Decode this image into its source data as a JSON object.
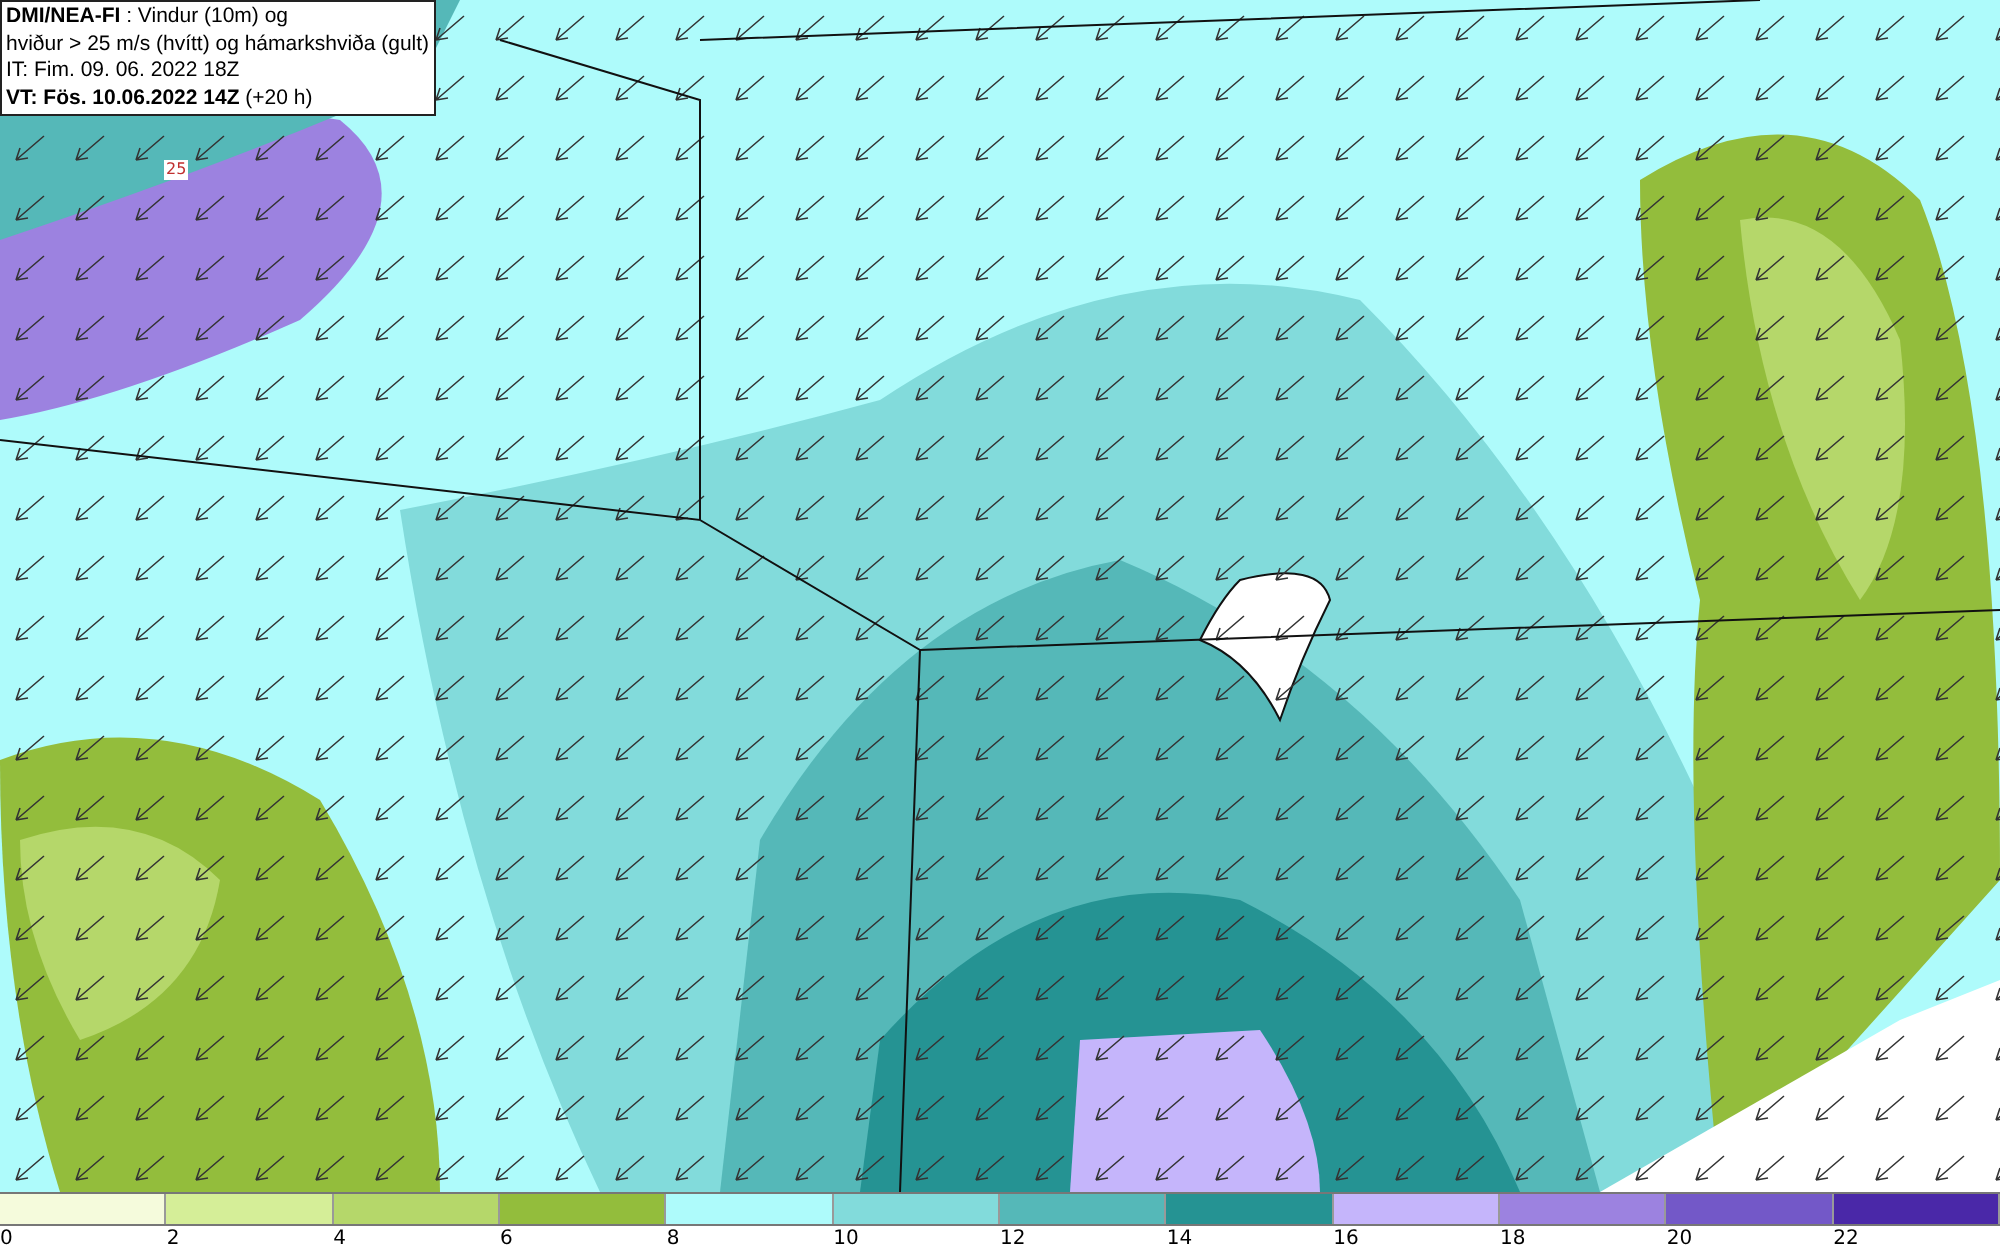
{
  "info_box": {
    "lines": [
      "**DMI/NEA-FI** : Vindur (10m) og",
      "hviður > 25 m/s (hvítt) og hámarkshviða (gult)",
      "IT: Fim. 09. 06. 2022 18Z",
      "**VT: Fös. 10.06.2022 14Z** (+20 h)"
    ]
  },
  "map": {
    "marker": "25"
  },
  "legend": {
    "swatches": [
      {
        "color": "#f5fbdc"
      },
      {
        "color": "#d5ee98"
      },
      {
        "color": "#b5d76a"
      },
      {
        "color": "#93bd3c"
      },
      {
        "color": "#aefbfb"
      },
      {
        "color": "#82dbdb"
      },
      {
        "color": "#55b8b8"
      },
      {
        "color": "#259393"
      },
      {
        "color": "#c5b5fb"
      },
      {
        "color": "#9c82e0"
      },
      {
        "color": "#7358c8"
      },
      {
        "color": "#4a28a8"
      }
    ],
    "labels": [
      "0",
      "2",
      "4",
      "6",
      "8",
      "10",
      "12",
      "14",
      "16",
      "18",
      "20",
      "22"
    ]
  }
}
